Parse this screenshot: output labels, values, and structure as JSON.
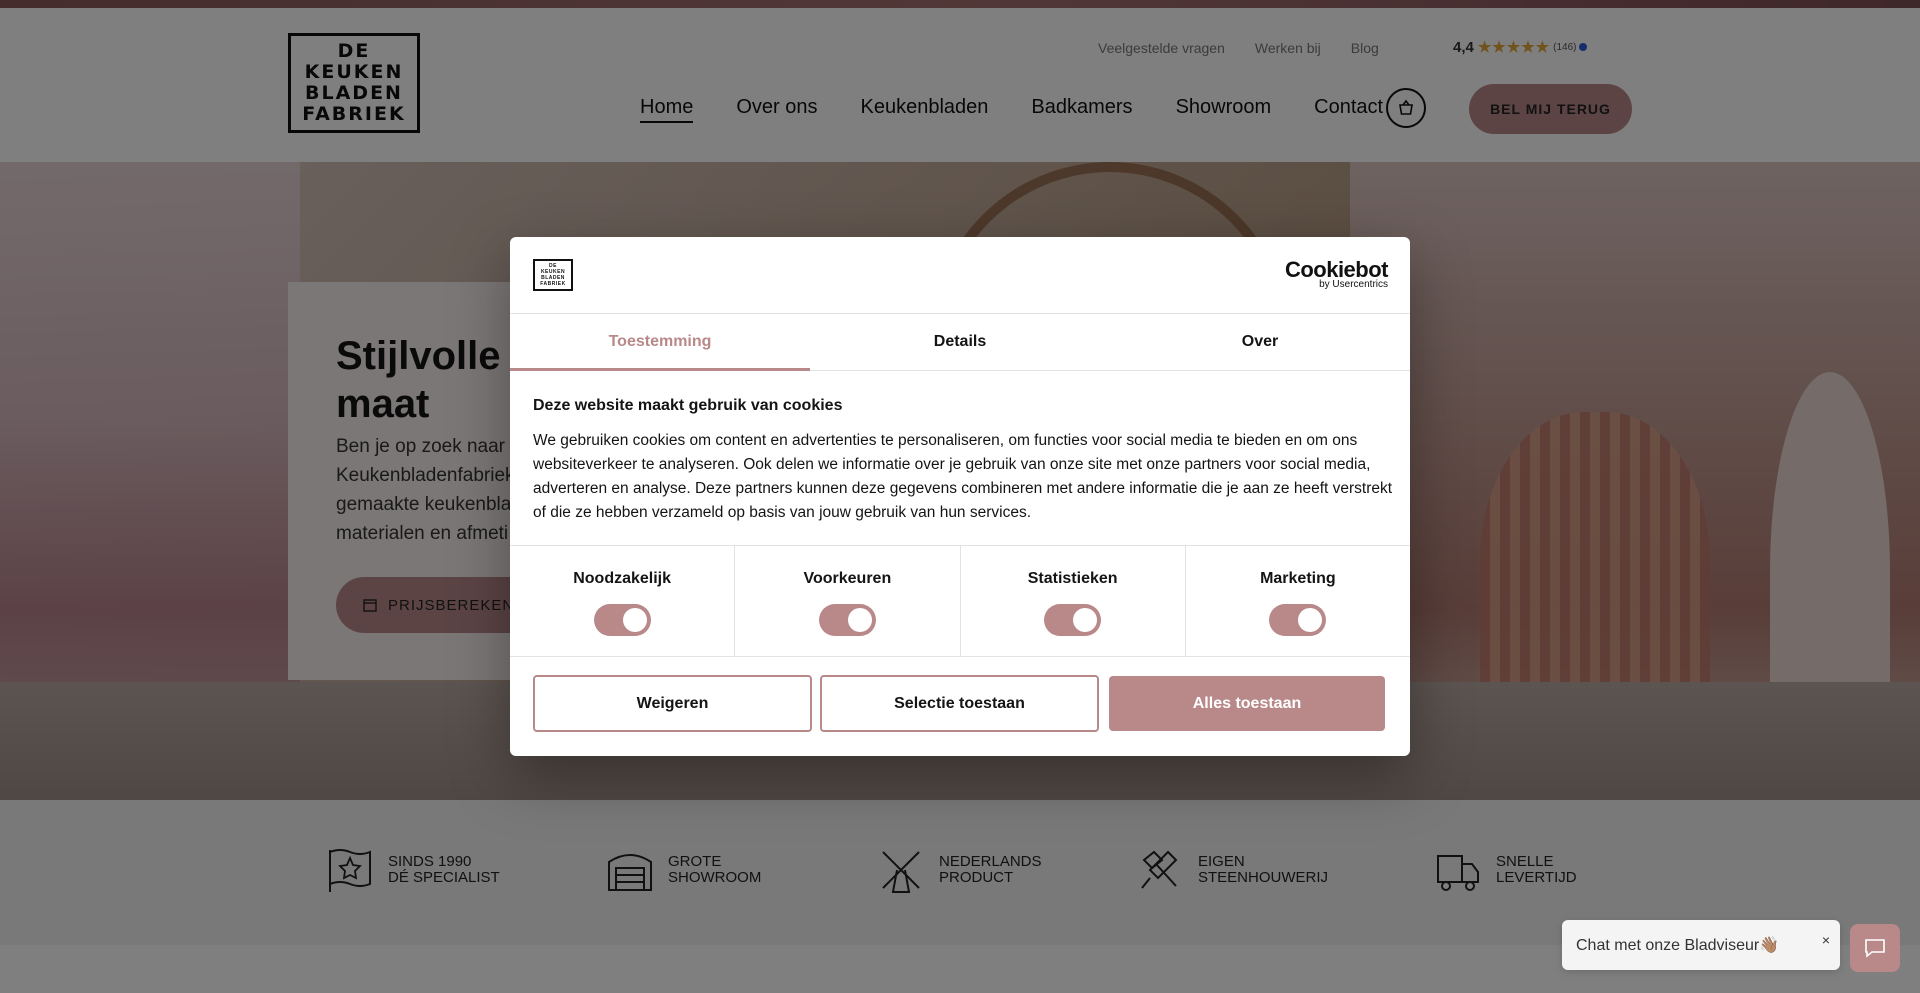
{
  "header": {
    "logo_lines": [
      "DE",
      "KEUKEN",
      "BLADEN",
      "FABRIEK"
    ],
    "utility_links": [
      "Veelgestelde vragen",
      "Werken bij",
      "Blog"
    ],
    "rating": {
      "score": "4,4",
      "stars": "★★★★★",
      "count": "(146)"
    },
    "nav": [
      "Home",
      "Over ons",
      "Keukenbladen",
      "Badkamers",
      "Showroom",
      "Contact"
    ],
    "callback_label": "BEL MIJ TERUG",
    "cart_icon": "basket-icon"
  },
  "hero": {
    "title": "Stijlvolle keukenbladen op maat",
    "title_visible": [
      "Stijlvolle k",
      "maat"
    ],
    "text_lines": [
      "Ben je op zoek naar e",
      "Keukenbladenfabriek",
      "gemaakte keukenbla",
      "materialen en afmeti"
    ],
    "cta_label": "PRIJSBEREKENI"
  },
  "usps": [
    {
      "icon": "flag-star-icon",
      "line1": "SINDS 1990",
      "line2": "DÉ SPECIALIST"
    },
    {
      "icon": "garage-icon",
      "line1": "GROTE",
      "line2": "SHOWROOM"
    },
    {
      "icon": "windmill-icon",
      "line1": "NEDERLANDS",
      "line2": "PRODUCT"
    },
    {
      "icon": "hammer-chisel-icon",
      "line1": "EIGEN",
      "line2": "STEENHOUWERIJ"
    },
    {
      "icon": "truck-icon",
      "line1": "SNELLE",
      "line2": "LEVERTIJD"
    }
  ],
  "cookie_dialog": {
    "brand": "Cookiebot",
    "brand_by": "by Usercentrics",
    "tabs": [
      "Toestemming",
      "Details",
      "Over"
    ],
    "active_tab": "Toestemming",
    "title": "Deze website maakt gebruik van cookies",
    "body": "We gebruiken cookies om content en advertenties te personaliseren, om functies voor social media te bieden en om ons websiteverkeer te analyseren. Ook delen we informatie over je gebruik van onze site met onze partners voor social media, adverteren en analyse. Deze partners kunnen deze gegevens combineren met andere informatie die je aan ze heeft verstrekt of die ze hebben verzameld op basis van jouw gebruik van hun services.",
    "categories": [
      {
        "label": "Noodzakelijk",
        "checked": true
      },
      {
        "label": "Voorkeuren",
        "checked": true
      },
      {
        "label": "Statistieken",
        "checked": true
      },
      {
        "label": "Marketing",
        "checked": true
      }
    ],
    "buttons": {
      "reject": "Weigeren",
      "allow_selection": "Selectie toestaan",
      "allow_all": "Alles toestaan"
    }
  },
  "chat": {
    "prompt": "Chat met onze Bladviseur👋🏽",
    "close": "×"
  },
  "colors": {
    "accent": "#b9898a",
    "text": "#141414"
  }
}
